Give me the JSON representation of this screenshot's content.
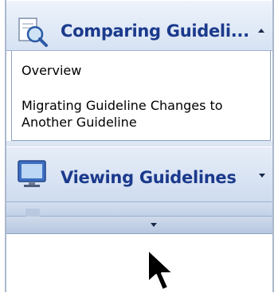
{
  "section_comparing": {
    "title": "Comparing Guideli...",
    "icon": "compare-search-icon",
    "state": "expanded",
    "items": [
      {
        "label": "Overview"
      },
      {
        "label": "Migrating Guideline Changes to Another Guideline"
      }
    ]
  },
  "section_viewing": {
    "title": "Viewing Guidelines",
    "icon": "monitor-icon",
    "state": "collapsed"
  },
  "overflow": {
    "icon": "chevron-down-icon"
  },
  "colors": {
    "header_text": "#1b3a8c",
    "header_bg_top": "#eef3fb",
    "header_bg_bottom": "#d6e2f3",
    "border": "#8ea3c2"
  }
}
